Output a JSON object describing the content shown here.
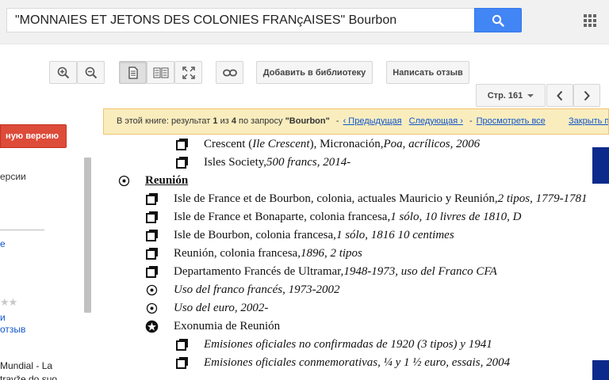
{
  "search": {
    "query": "\"MONNAIES ET JETONS DES COLONIES FRANçAISES\" Bourbon",
    "button_icon": "search-icon",
    "apps_icon": "apps-grid-icon"
  },
  "toolbar": {
    "zoom_in_icon": "zoom-in-icon",
    "zoom_out_icon": "zoom-out-icon",
    "single_page_icon": "single-page-icon",
    "two_page_icon": "two-page-icon",
    "fullscreen_icon": "fullscreen-icon",
    "link_icon": "link-icon",
    "add_library_label": "Добавить в библиотеку",
    "write_review_label": "Написать отзыв",
    "page_label": "Стр. 161",
    "prev_icon": "chevron-left-icon",
    "next_icon": "chevron-right-icon"
  },
  "sidebar": {
    "buy_button_label": "ную версию",
    "versions_text": "ерсии",
    "link_e": "е",
    "stars_text": "★★",
    "link_n": "и",
    "reviews_link": "отзыв",
    "related_title_1": "Mundial - La",
    "related_title_2": "travže do suo"
  },
  "banner": {
    "prefix": "В этой книге: результат",
    "current": "1",
    "of_word": "из",
    "total": "4",
    "by_query": "по запросу",
    "query": "\"Bourbon\"",
    "prev_link": "‹ Предыдущая",
    "next_link": "Следующая ›",
    "view_all_link": "Просмотреть все",
    "close_link": "Закрыть п"
  },
  "book": {
    "lines": [
      {
        "normal": "Crescent (",
        "italic": "Ile Crescent",
        "normal2": "), Micronación, ",
        "italic2": "Poa, acrílicos, 2006"
      },
      {
        "normal": "Isles Society, ",
        "italic": "500 francs, 2014-"
      },
      {
        "heading": "Reunión"
      },
      {
        "normal": "Isle de France et de Bourbon, colonia, actuales Mauricio y Reunión, ",
        "italic": "2 tipos, 1779-1781"
      },
      {
        "normal": "Isle de France et Bonaparte, colonia francesa, ",
        "italic": "1 sólo, 10 livres de 1810, D"
      },
      {
        "normal": "Isle de Bourbon, colonia francesa, ",
        "italic": "1 sólo, 1816 10 centimes"
      },
      {
        "normal": "Reunión, colonia francesa, ",
        "italic": "1896, 2 tipos"
      },
      {
        "normal": "Departamento Francés de Ultramar, ",
        "italic": "1948-1973, uso del  Franco CFA"
      },
      {
        "italic": "Uso del franco francés, 1973-2002"
      },
      {
        "italic": "Uso del euro, 2002-"
      },
      {
        "normal": "Exonumia de Reunión"
      },
      {
        "italic": "Emisiones oficiales no confirmadas de 1920 (3 tipos) y 1941"
      },
      {
        "italic": "Emisiones oficiales conmemorativas, ¼ y 1 ½ euro, essais, 2004"
      }
    ]
  },
  "colors": {
    "search_blue": "#4285f4",
    "buy_red": "#dd4b39",
    "banner_yellow": "#f9edbe",
    "link_blue": "#1155cc",
    "page_block_blue": "#0b2a8c"
  }
}
